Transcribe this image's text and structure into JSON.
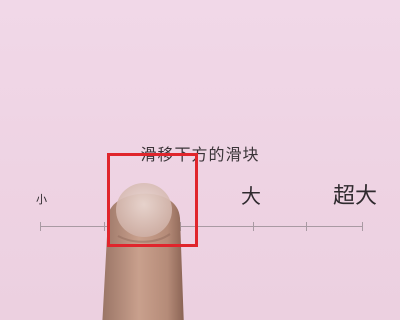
{
  "instruction": {
    "text": "滑移下方的滑块"
  },
  "font_size_slider": {
    "labels": {
      "small": "小",
      "large": "大",
      "extra_large": "超大"
    }
  },
  "colors": {
    "background": "#efd6e6",
    "highlight": "#e0252c",
    "track": "#a99aa3"
  },
  "icons": {
    "finger": "finger-icon"
  }
}
